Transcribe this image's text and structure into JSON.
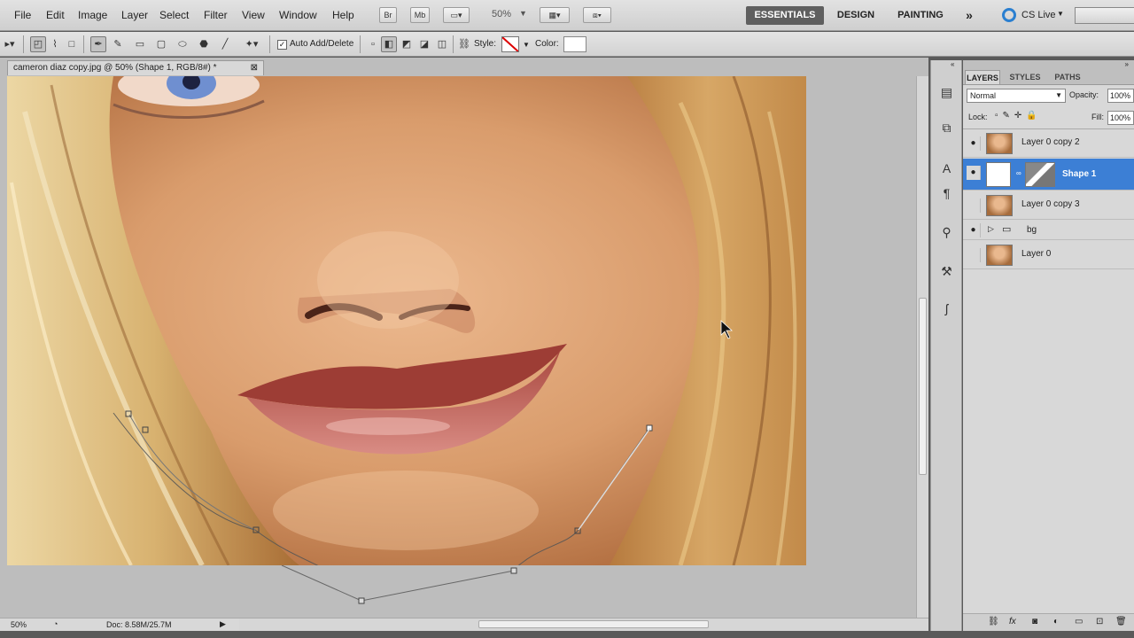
{
  "menu": {
    "items": [
      "File",
      "Edit",
      "Image",
      "Layer",
      "Select",
      "Filter",
      "View",
      "Window",
      "Help"
    ],
    "zoom": "50%",
    "workspaces": [
      "ESSENTIALS",
      "DESIGN",
      "PAINTING"
    ],
    "more": "»",
    "cslive": "CS Live"
  },
  "options": {
    "auto_add_delete": "Auto Add/Delete",
    "style_label": "Style:",
    "color_label": "Color:"
  },
  "document": {
    "tab_title": "cameron diaz copy.jpg @ 50% (Shape 1, RGB/8#) *",
    "status_zoom": "50%",
    "doc_size": "Doc: 8.58M/25.7M"
  },
  "layers_panel": {
    "tabs": [
      "LAYERS",
      "STYLES",
      "PATHS"
    ],
    "blend_mode": "Normal",
    "opacity_label": "Opacity:",
    "opacity_value": "100%",
    "lock_label": "Lock:",
    "fill_label": "Fill:",
    "fill_value": "100%",
    "layers": [
      {
        "name": "Layer 0 copy 2",
        "visible": true
      },
      {
        "name": "Shape 1",
        "visible": true,
        "active": true
      },
      {
        "name": "Layer 0 copy 3",
        "visible": false
      },
      {
        "name": "bg",
        "visible": true,
        "group": true
      },
      {
        "name": "Layer 0",
        "visible": false
      }
    ]
  },
  "colors": {
    "selection": "#3c7fd5",
    "skin": "#d49a6e",
    "hair": "#c98d4e"
  }
}
